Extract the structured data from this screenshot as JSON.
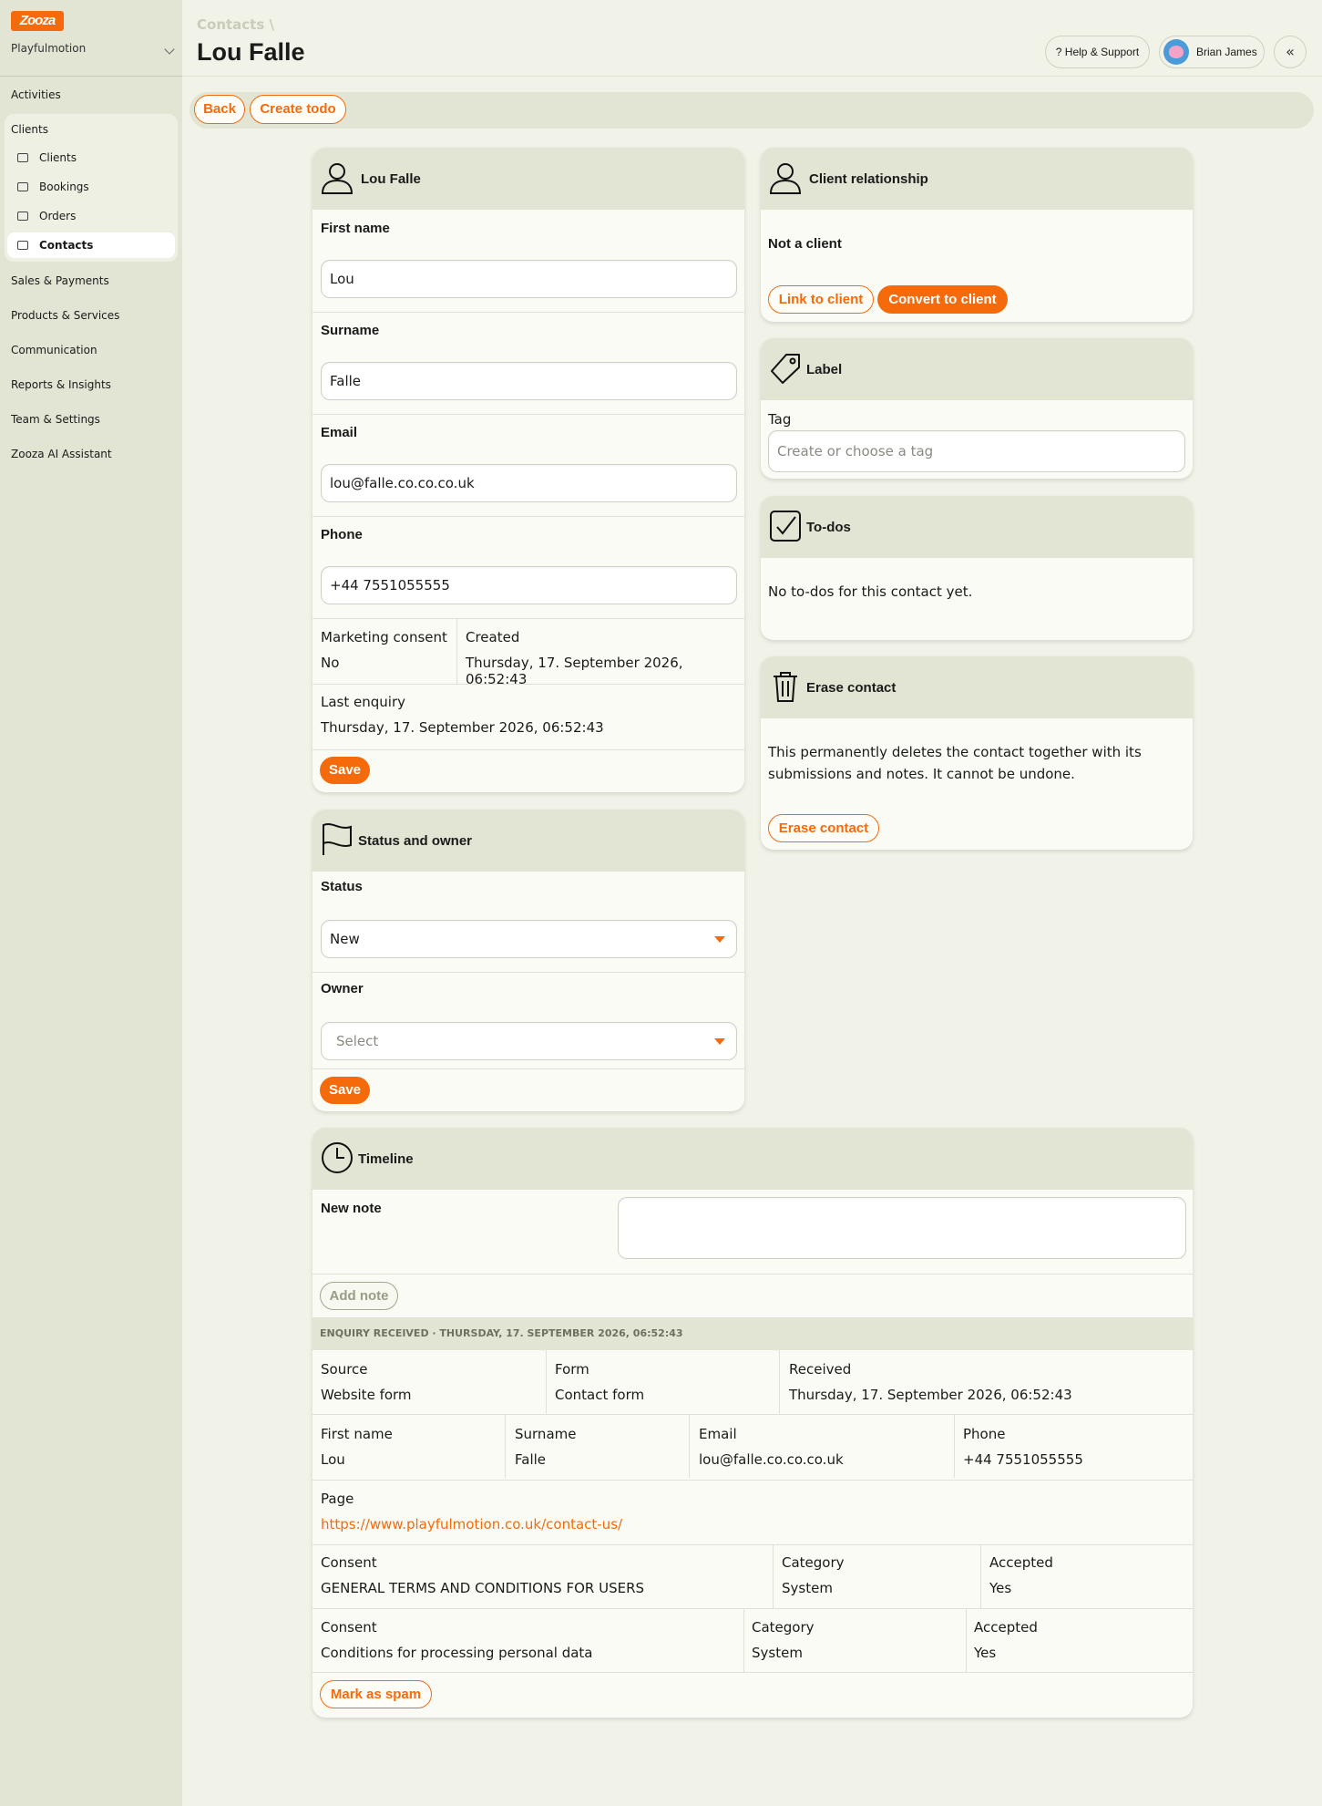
{
  "brand": {
    "logo_text": "Zooza",
    "org_name": "Playfulmotion",
    "accent": "#f56a0a"
  },
  "sidebar": {
    "activities": "Activities",
    "clients_group": "Clients",
    "clients_items": [
      "Clients",
      "Bookings",
      "Orders",
      "Contacts"
    ],
    "items": [
      "Sales & Payments",
      "Products & Services",
      "Communication",
      "Reports & Insights",
      "Team & Settings",
      "Zooza AI Assistant"
    ]
  },
  "header": {
    "breadcrumb": "Contacts \\",
    "title": "Lou Falle",
    "help": "? Help & Support",
    "user": "Brian James",
    "collapse_icon": "«"
  },
  "actions": {
    "back": "Back",
    "create_todo": "Create todo"
  },
  "contact": {
    "title": "Lou Falle",
    "first_name_label": "First name",
    "first_name": "Lou",
    "surname_label": "Surname",
    "surname": "Falle",
    "email_label": "Email",
    "email": "lou@falle.co.co.co.uk",
    "phone_label": "Phone",
    "phone": "+44 7551055555",
    "marketing_label": "Marketing consent",
    "marketing": "No",
    "created_label": "Created",
    "created": "Thursday, 17. September 2026, 06:52:43",
    "last_enquiry_label": "Last enquiry",
    "last_enquiry": "Thursday, 17. September 2026, 06:52:43",
    "save": "Save"
  },
  "status": {
    "title": "Status and owner",
    "status_label": "Status",
    "status_value": "New",
    "owner_label": "Owner",
    "owner_placeholder": "Select",
    "save": "Save"
  },
  "relationship": {
    "title": "Client relationship",
    "state": "Not a client",
    "link": "Link to client",
    "convert": "Convert to client"
  },
  "label": {
    "title": "Label",
    "tag_label": "Tag",
    "tag_placeholder": "Create or choose a tag"
  },
  "todos": {
    "title": "To-dos",
    "empty": "No to-dos for this contact yet."
  },
  "erase": {
    "title": "Erase contact",
    "desc_1": "This permanently deletes the contact together with its",
    "desc_2": "submissions and notes. It cannot be undone.",
    "button": "Erase contact"
  },
  "timeline": {
    "title": "Timeline",
    "new_note_label": "New note",
    "add_note": "Add note",
    "event_header": "ENQUIRY RECEIVED · THURSDAY, 17. SEPTEMBER 2026, 06:52:43",
    "source_label": "Source",
    "source": "Website form",
    "form_label": "Form",
    "form": "Contact form",
    "received_label": "Received",
    "received": "Thursday, 17. September 2026, 06:52:43",
    "first_name_label": "First name",
    "first_name": "Lou",
    "surname_label": "Surname",
    "surname": "Falle",
    "email_label": "Email",
    "email": "lou@falle.co.co.co.uk",
    "phone_label": "Phone",
    "phone": "+44 7551055555",
    "page_label": "Page",
    "page_url": "https://www.playfulmotion.co.uk/contact-us/",
    "consents": [
      {
        "consent_label": "Consent",
        "consent": "GENERAL TERMS AND CONDITIONS FOR USERS",
        "category_label": "Category",
        "category": "System",
        "accepted_label": "Accepted",
        "accepted": "Yes"
      },
      {
        "consent_label": "Consent",
        "consent": "Conditions for processing personal data",
        "category_label": "Category",
        "category": "System",
        "accepted_label": "Accepted",
        "accepted": "Yes"
      }
    ],
    "spam": "Mark as spam"
  }
}
